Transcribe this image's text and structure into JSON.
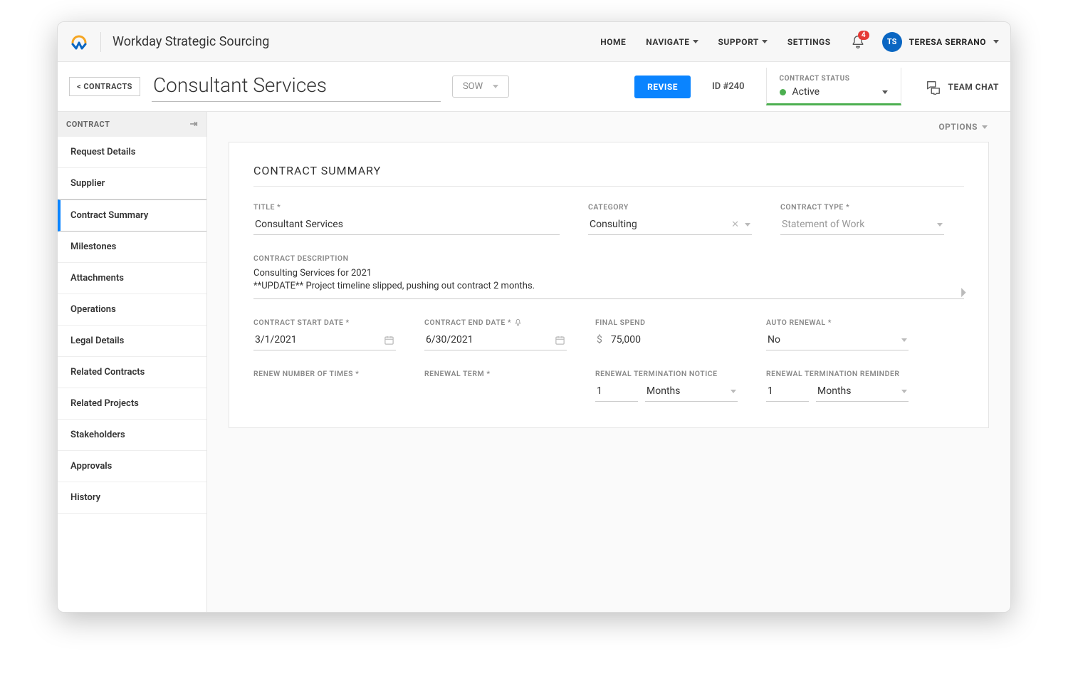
{
  "brand": "Workday Strategic Sourcing",
  "topnav": {
    "links": [
      "HOME",
      "NAVIGATE",
      "SUPPORT",
      "SETTINGS"
    ],
    "notif_count": "4",
    "user_initials": "TS",
    "user_name": "TERESA SERRANO"
  },
  "subheader": {
    "back_label": "< CONTRACTS",
    "title": "Consultant Services",
    "type_select": "SOW",
    "revise_label": "REVISE",
    "id_label": "ID #240",
    "status_label": "CONTRACT STATUS",
    "status_value": "Active",
    "teamchat_label": "TEAM CHAT"
  },
  "sidebar": {
    "header": "CONTRACT",
    "items": [
      "Request Details",
      "Supplier",
      "Contract Summary",
      "Milestones",
      "Attachments",
      "Operations",
      "Legal Details",
      "Related Contracts",
      "Related Projects",
      "Stakeholders",
      "Approvals",
      "History"
    ],
    "active_index": 2
  },
  "content": {
    "options_label": "OPTIONS",
    "card_title": "CONTRACT SUMMARY",
    "fields": {
      "title_label": "TITLE *",
      "title_value": "Consultant Services",
      "category_label": "CATEGORY",
      "category_value": "Consulting",
      "ctype_label": "CONTRACT TYPE *",
      "ctype_value": "Statement of Work",
      "desc_label": "CONTRACT DESCRIPTION",
      "desc_line1": "Consulting Services for 2021",
      "desc_line2": "**UPDATE** Project timeline slipped, pushing out contract 2 months.",
      "start_label": "CONTRACT START DATE *",
      "start_value": "3/1/2021",
      "end_label": "CONTRACT END DATE *",
      "end_value": "6/30/2021",
      "spend_label": "FINAL SPEND",
      "spend_currency": "$",
      "spend_value": "75,000",
      "auto_label": "AUTO RENEWAL *",
      "auto_value": "No",
      "rnum_label": "RENEW NUMBER OF TIMES *",
      "rterm_label": "RENEWAL TERM *",
      "rnotice_label": "RENEWAL TERMINATION NOTICE",
      "rnotice_val": "1",
      "rnotice_unit": "Months",
      "rremind_label": "RENEWAL TERMINATION REMINDER",
      "rremind_val": "1",
      "rremind_unit": "Months"
    }
  }
}
